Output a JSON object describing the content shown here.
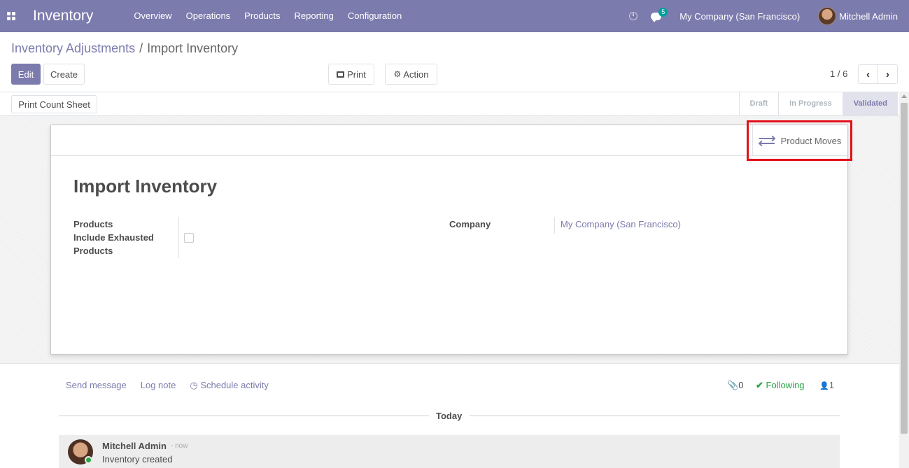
{
  "app": {
    "title": "Inventory",
    "menu": [
      "Overview",
      "Operations",
      "Products",
      "Reporting",
      "Configuration"
    ],
    "chat_badge": "5",
    "company": "My Company (San Francisco)",
    "user": "Mitchell Admin"
  },
  "breadcrumb": {
    "parent": "Inventory Adjustments",
    "separator": "/",
    "current": "Import Inventory"
  },
  "toolbar": {
    "edit_label": "Edit",
    "create_label": "Create",
    "print_label": "Print",
    "action_label": "Action",
    "pager": "1 / 6",
    "prev_icon": "chevron-left-icon",
    "next_icon": "chevron-right-icon"
  },
  "statusbar": {
    "print_count_sheet_label": "Print Count Sheet",
    "steps": [
      "Draft",
      "In Progress",
      "Validated"
    ],
    "active_step": "Validated"
  },
  "form": {
    "smart_button_label": "Product Moves",
    "smart_button_icon": "exchange-icon",
    "title": "Import Inventory",
    "products_label": "Products",
    "include_exhausted_label_line1": "Include Exhausted",
    "include_exhausted_label_line2": "Products",
    "include_exhausted_value": false,
    "company_label": "Company",
    "company_value": "My Company (San Francisco)"
  },
  "chatter": {
    "send_message": "Send message",
    "log_note": "Log note",
    "schedule_activity": "Schedule activity",
    "attachments_count": "0",
    "following_label": "Following",
    "followers_count": "1",
    "day_separator": "Today",
    "messages": [
      {
        "author": "Mitchell Admin",
        "date": "- now",
        "body": "Inventory created"
      }
    ]
  },
  "colors": {
    "brand": "#7c7bad",
    "highlight": "#e3101b",
    "following": "#28a745",
    "badge": "#00a09d"
  }
}
